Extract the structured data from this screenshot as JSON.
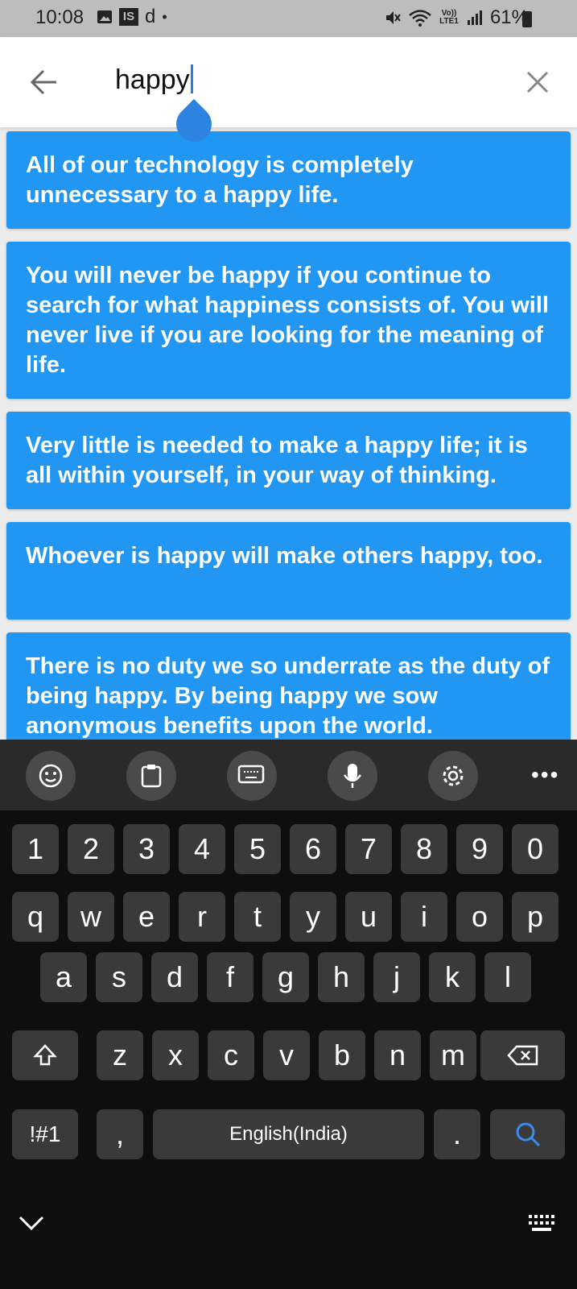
{
  "status_bar": {
    "time": "10:08",
    "left_icons": [
      "image-icon",
      "is-icon",
      "d-icon",
      "dot-icon"
    ],
    "is_text": "IS",
    "d_text": "d",
    "dot_text": "•",
    "right_icons": [
      "mute-icon",
      "wifi-icon",
      "volte-icon",
      "signal-icon"
    ],
    "volte_text": "Vo)) LTE1",
    "battery": "61%"
  },
  "header": {
    "search_value": "happy",
    "back_icon": "arrow-left-icon",
    "close_icon": "close-icon"
  },
  "quotes": [
    "All of our technology is completely unnecessary to a happy life.",
    "You will never be happy if you continue to search for what happiness consists of. You will never live if you are looking for the meaning of life.",
    "Very little is needed to make a happy life; it is all within yourself, in your way of thinking.",
    "Whoever is happy will make others happy, too.",
    "There is no duty we so underrate as the duty of being happy. By being happy we sow anonymous benefits upon the world."
  ],
  "keyboard": {
    "toolbar": [
      "emoji-icon",
      "clipboard-icon",
      "keyboard-icon",
      "mic-icon",
      "settings-icon",
      "more-icon"
    ],
    "more_label": "•••",
    "row_numbers": [
      "1",
      "2",
      "3",
      "4",
      "5",
      "6",
      "7",
      "8",
      "9",
      "0"
    ],
    "row_q": [
      "q",
      "w",
      "e",
      "r",
      "t",
      "y",
      "u",
      "i",
      "o",
      "p"
    ],
    "row_a": [
      "a",
      "s",
      "d",
      "f",
      "g",
      "h",
      "j",
      "k",
      "l"
    ],
    "row_z": [
      "z",
      "x",
      "c",
      "v",
      "b",
      "n",
      "m"
    ],
    "symbols_label": "!#1",
    "comma_label": ",",
    "space_label": "English(India)",
    "period_label": ".",
    "search_key_icon": "search-icon",
    "shift_icon": "shift-icon",
    "backspace_icon": "backspace-icon",
    "hide_icon": "chevron-down-icon",
    "switch_icon": "keyboard-icon"
  }
}
